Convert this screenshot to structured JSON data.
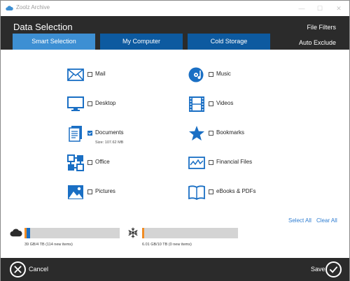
{
  "window": {
    "title": "Zoolz Archive"
  },
  "header": {
    "title": "Data Selection",
    "file_filters": "File Filters",
    "auto_exclude": "Auto Exclude",
    "tabs": [
      "Smart Selection",
      "My Computer",
      "Cold Storage"
    ],
    "active_tab": "Smart Selection"
  },
  "options": {
    "mail": {
      "label": "Mail",
      "checked": false,
      "icon": "mail-icon"
    },
    "desktop": {
      "label": "Desktop",
      "checked": false,
      "icon": "monitor-icon"
    },
    "documents": {
      "label": "Documents",
      "checked": true,
      "size": "Size: 107.62 MB",
      "icon": "documents-icon"
    },
    "office": {
      "label": "Office",
      "checked": false,
      "icon": "office-icon"
    },
    "pictures": {
      "label": "Pictures",
      "checked": false,
      "icon": "picture-icon"
    },
    "music": {
      "label": "Music",
      "checked": false,
      "icon": "music-icon"
    },
    "videos": {
      "label": "Videos",
      "checked": false,
      "icon": "film-icon"
    },
    "bookmarks": {
      "label": "Bookmarks",
      "checked": false,
      "icon": "star-icon"
    },
    "financial": {
      "label": "Financial Files",
      "checked": false,
      "icon": "chart-icon"
    },
    "ebooks": {
      "label": "eBooks & PDFs",
      "checked": false,
      "icon": "book-icon"
    }
  },
  "actions": {
    "select_all": "Select All",
    "clear_all": "Clear All"
  },
  "storage": {
    "cloud": {
      "caption": "39 GB/4 TB (114 new items)",
      "icon": "cloud-icon",
      "used_fraction": 0.02,
      "new_fraction": 0.04
    },
    "cold": {
      "caption": "6.01 GB/10 TB (0 new items)",
      "icon": "snowflake-icon",
      "used_fraction": 0.02
    }
  },
  "footer": {
    "cancel": "Cancel",
    "save": "Save"
  },
  "colors": {
    "header_bg": "#2b2b2b",
    "tab": "#0d5aa0",
    "tab_active": "#3d8fd3",
    "icon_blue": "#1a6fc4",
    "link": "#2d7cd1",
    "bar_orange": "#f08c24",
    "bar_blue": "#1a6fc4"
  }
}
